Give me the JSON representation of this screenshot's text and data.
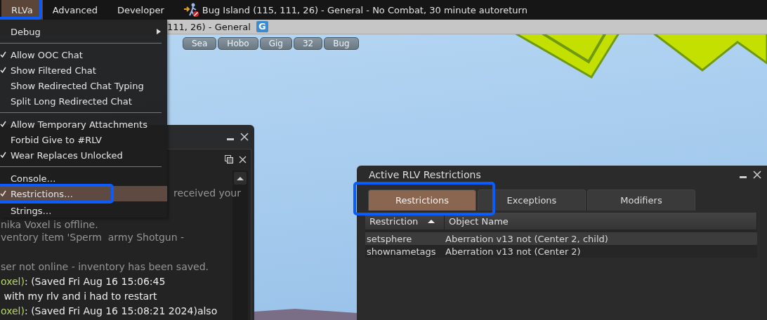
{
  "menu_bar": {
    "items": [
      {
        "label": "RLVa",
        "selected": true
      },
      {
        "label": "Advanced",
        "selected": false
      },
      {
        "label": "Developer",
        "selected": false
      }
    ],
    "location": "Bug Island (115, 111, 26) - General - No Combat, 30 minute autoreturn"
  },
  "navigation_bar": {
    "location": "111, 26) - General",
    "badge": "G"
  },
  "favorites": [
    "Sea",
    "Hobo",
    "Gig",
    "32",
    "Bug"
  ],
  "rlva_menu": {
    "items": [
      {
        "kind": "submenu",
        "label": "Debug"
      },
      {
        "kind": "separator"
      },
      {
        "kind": "item",
        "label": "Allow OOC Chat",
        "checked": true,
        "selected": false
      },
      {
        "kind": "item",
        "label": "Show Filtered Chat",
        "checked": true,
        "selected": false
      },
      {
        "kind": "item",
        "label": "Show Redirected Chat Typing",
        "checked": false,
        "selected": false
      },
      {
        "kind": "item",
        "label": "Split Long Redirected Chat",
        "checked": false,
        "selected": false
      },
      {
        "kind": "separator"
      },
      {
        "kind": "item",
        "label": "Allow Temporary Attachments",
        "checked": true,
        "selected": false
      },
      {
        "kind": "item",
        "label": "Forbid Give to #RLV",
        "checked": false,
        "selected": false
      },
      {
        "kind": "item",
        "label": "Wear Replaces Unlocked",
        "checked": true,
        "selected": false
      },
      {
        "kind": "separator"
      },
      {
        "kind": "item",
        "label": "Console…",
        "checked": false,
        "selected": false
      },
      {
        "kind": "item",
        "label": "Restrictions…",
        "checked": true,
        "selected": true
      },
      {
        "kind": "item",
        "label": "Strings…",
        "checked": false,
        "selected": false
      }
    ]
  },
  "chat_window": {
    "lines": [
      {
        "kind": "system",
        "text": "received your"
      },
      {
        "kind": "system",
        "text": "nika Voxel is offline."
      },
      {
        "kind": "system",
        "text": "ventory item 'Sperm  army Shotgun -"
      },
      {
        "kind": "system",
        "text": "ser not online - inventory has been saved."
      },
      {
        "kind": "message",
        "speaker": "oxel)",
        "text": ": (Saved Fri Aug 16 15:06:45"
      },
      {
        "kind": "message",
        "text": " with my rlv and i had to restart"
      },
      {
        "kind": "message",
        "speaker": "oxel)",
        "text": ": (Saved Fri Aug 16 15:08:21 2024)also"
      }
    ]
  },
  "restrictions_window": {
    "title": "Active RLV Restrictions",
    "tabs": [
      {
        "label": "Restrictions",
        "selected": true
      },
      {
        "label": "Exceptions",
        "selected": false
      },
      {
        "label": "Modifiers",
        "selected": false
      }
    ],
    "columns": [
      {
        "label": "Restriction",
        "sort_ascending": true
      },
      {
        "label": "Object Name"
      }
    ],
    "rows": [
      {
        "cells": [
          "setsphere",
          "Aberration v13 not (Center 2, child)"
        ],
        "selected": true
      },
      {
        "cells": [
          "shownametags",
          "Aberration v13 not (Center 2)"
        ],
        "selected": false
      }
    ]
  }
}
